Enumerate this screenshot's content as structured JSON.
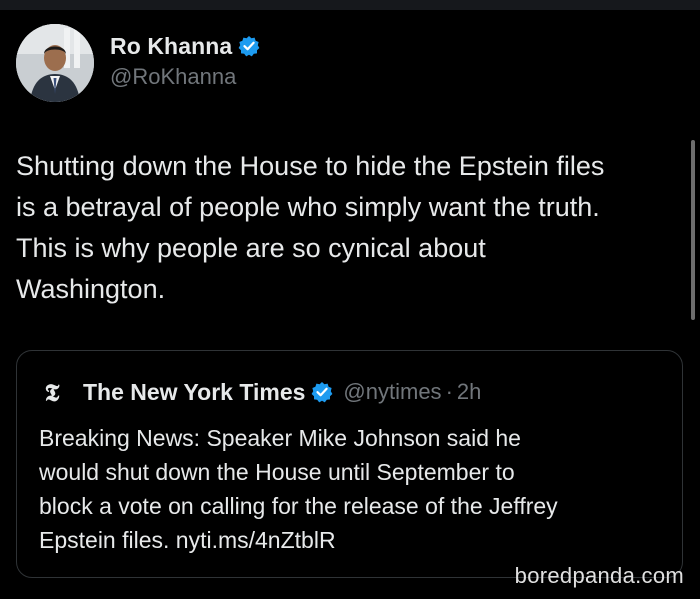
{
  "author": {
    "display_name": "Ro Khanna",
    "handle": "@RoKhanna",
    "avatar_icon": "user-avatar"
  },
  "tweet": {
    "text": "Shutting down the House to hide the Epstein files\nis a betrayal of people who simply want the truth.\nThis is why people are so cynical about\nWashington."
  },
  "quoted": {
    "logo_glyph": "𝕿",
    "display_name": "The New York Times",
    "handle": "@nytimes",
    "separator": "·",
    "time": "2h",
    "text": "Breaking News: Speaker Mike Johnson said he\nwould shut down the House until September to\nblock a vote on calling for the release of the Jeffrey\nEpstein files. nyti.ms/4nZtblR"
  },
  "watermark": {
    "text": "boredpanda.com"
  },
  "colors": {
    "background": "#000000",
    "primary_text": "#e7e9ea",
    "secondary_text": "#71767b",
    "verified_blue": "#1d9bf0",
    "card_border": "#2f3336"
  }
}
